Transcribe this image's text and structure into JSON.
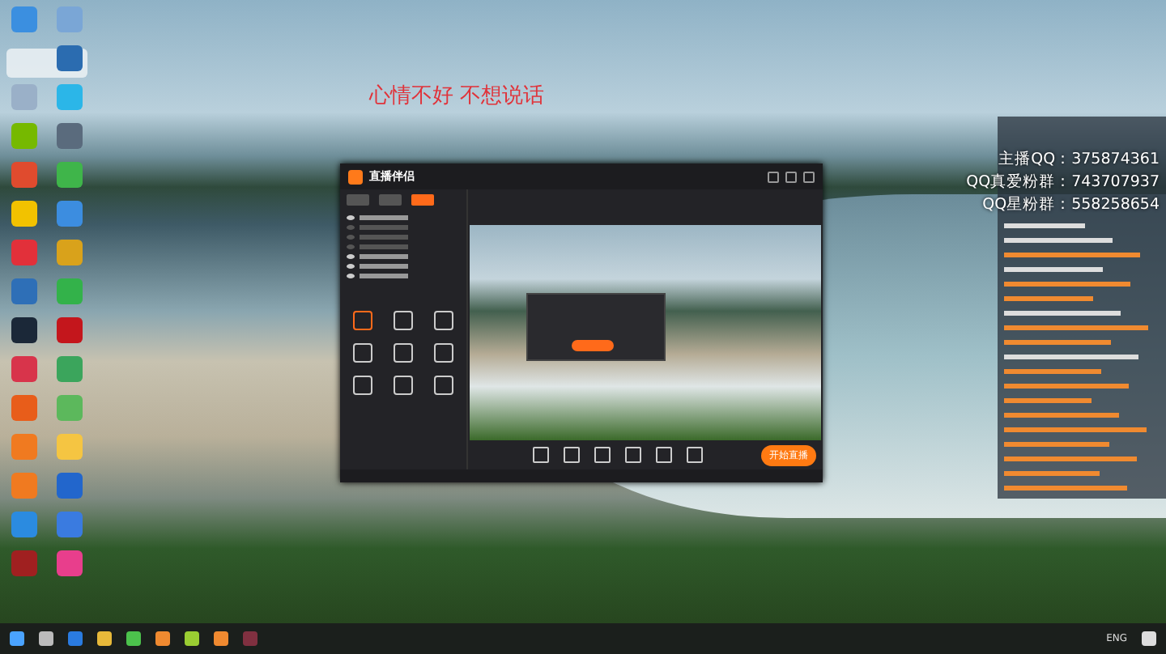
{
  "desktop": {
    "overlay_text": "心情不好 不想说话",
    "icons": [
      {
        "color": "#3b8fe0"
      },
      {
        "color": "#7aa6d6"
      },
      {
        "color": "#2b6cb0"
      },
      {
        "color": "#9ab0c8"
      },
      {
        "color": "#2bb6e8"
      },
      {
        "color": "#76b900"
      },
      {
        "color": "#5a6b7d"
      },
      {
        "color": "#e04b2e"
      },
      {
        "color": "#3fb54a"
      },
      {
        "color": "#f2c200"
      },
      {
        "color": "#3c8de0"
      },
      {
        "color": "#e2303a"
      },
      {
        "color": "#d9a21b"
      },
      {
        "color": "#2e6fb7"
      },
      {
        "color": "#33b24a"
      },
      {
        "color": "#1b2838"
      },
      {
        "color": "#c4161c"
      },
      {
        "color": "#d8344b"
      },
      {
        "color": "#3ba55c"
      },
      {
        "color": "#e85d1a"
      },
      {
        "color": "#5cb85c"
      },
      {
        "color": "#f07a20"
      },
      {
        "color": "#f5c542"
      },
      {
        "color": "#f07a20"
      },
      {
        "color": "#2266cc"
      },
      {
        "color": "#2b8be0"
      },
      {
        "color": "#3a7be0"
      },
      {
        "color": "#a02020"
      },
      {
        "color": "#e83e8c"
      }
    ]
  },
  "app_window": {
    "title": "直播伴侣",
    "tabs": [
      {
        "selected": false
      },
      {
        "selected": false
      },
      {
        "selected": true
      }
    ],
    "scenes": [
      {
        "visible": true
      },
      {
        "visible": false
      },
      {
        "visible": false
      },
      {
        "visible": false
      },
      {
        "visible": true
      },
      {
        "visible": true
      },
      {
        "visible": true
      }
    ],
    "tools": [
      {
        "color": "#ff6a1a"
      },
      {
        "color": "#cccccc"
      },
      {
        "color": "#cccccc"
      },
      {
        "color": "#cccccc"
      },
      {
        "color": "#cccccc"
      },
      {
        "color": "#cccccc"
      },
      {
        "color": "#cccccc"
      },
      {
        "color": "#cccccc"
      },
      {
        "color": "#cccccc"
      }
    ],
    "start_button": "开始直播"
  },
  "chat_panel": {
    "qq_lines": [
      "主播QQ：375874361",
      "QQ真爱粉群：743707937",
      "QQ星粉群：558258654"
    ],
    "lines": [
      {
        "color": "#dddddd"
      },
      {
        "color": "#dddddd"
      },
      {
        "color": "#f08a30"
      },
      {
        "color": "#dddddd"
      },
      {
        "color": "#f08a30"
      },
      {
        "color": "#f08a30"
      },
      {
        "color": "#dddddd"
      },
      {
        "color": "#f08a30"
      },
      {
        "color": "#f08a30"
      },
      {
        "color": "#dddddd"
      },
      {
        "color": "#f08a30"
      },
      {
        "color": "#f08a30"
      },
      {
        "color": "#f08a30"
      },
      {
        "color": "#f08a30"
      },
      {
        "color": "#f08a30"
      },
      {
        "color": "#f08a30"
      },
      {
        "color": "#f08a30"
      },
      {
        "color": "#f08a30"
      },
      {
        "color": "#f08a30"
      }
    ]
  },
  "taskbar": {
    "language": "ENG"
  }
}
